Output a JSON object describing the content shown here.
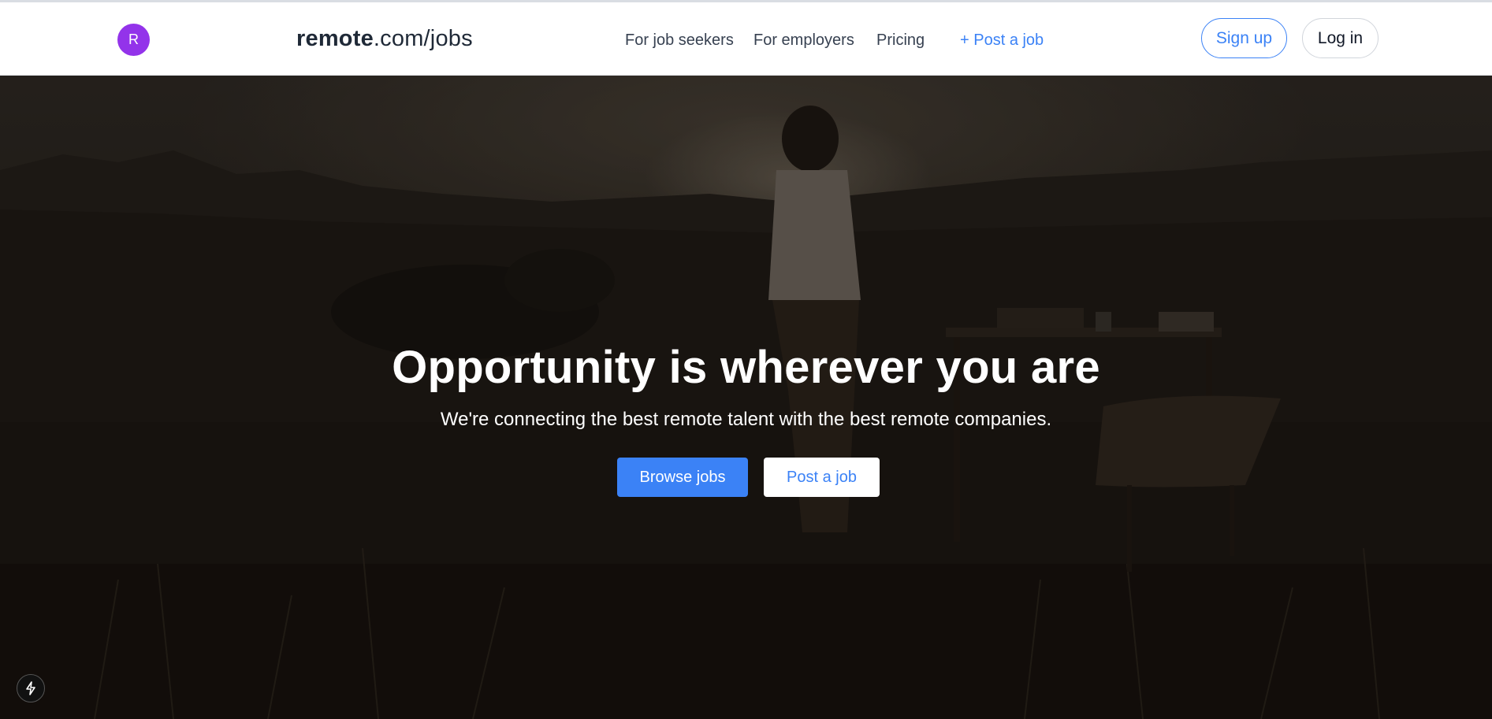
{
  "header": {
    "avatar_initial": "R",
    "brand_bold": "remote",
    "brand_rest": ".com/jobs",
    "nav": {
      "job_seekers": "For job seekers",
      "employers": "For employers",
      "pricing": "Pricing",
      "post_job": "+ Post a job"
    },
    "sign_up": "Sign up",
    "log_in": "Log in"
  },
  "hero": {
    "title": "Opportunity is wherever you are",
    "subtitle": "We're connecting the best remote talent with the best remote companies.",
    "browse_button": "Browse jobs",
    "post_button": "Post a job",
    "background_image": "person standing in desert landscape next to an outdoor desk and chair at sunset"
  },
  "widget": {
    "icon": "lightning-bolt-icon"
  },
  "colors": {
    "accent": "#3b82f6",
    "avatar": "#9333ea",
    "brand_text": "#1f2937"
  }
}
